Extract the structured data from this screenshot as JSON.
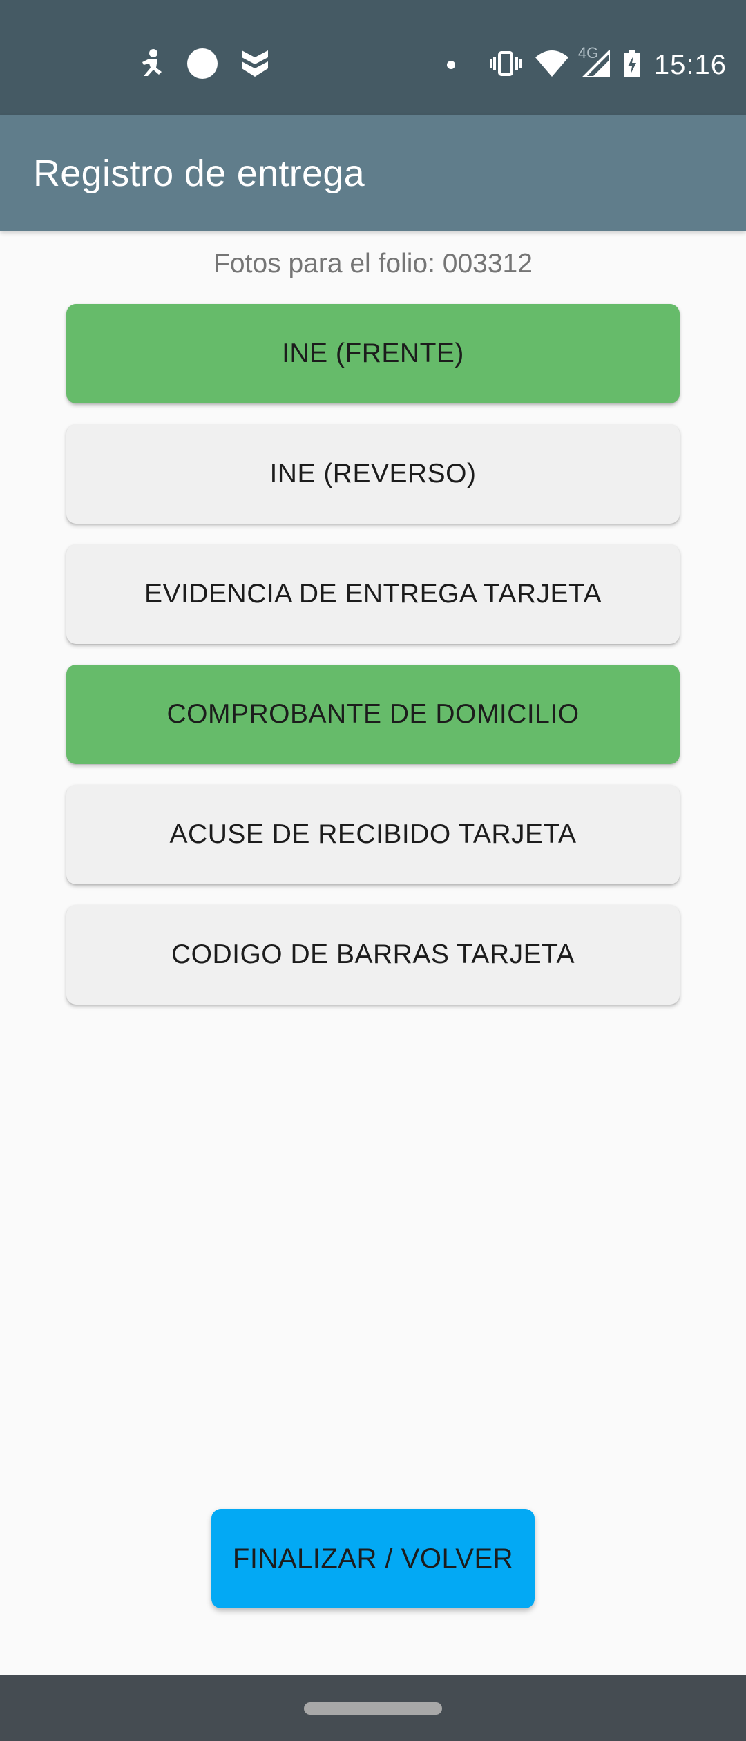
{
  "status_bar": {
    "time": "15:16",
    "network_type": "4G",
    "left_icons": [
      "accessibility-icon",
      "circle-icon",
      "badge-icon"
    ],
    "right_icons": [
      "dot-icon",
      "vibrate-icon",
      "wifi-icon",
      "signal-icon",
      "battery-charging-icon"
    ]
  },
  "app_bar": {
    "title": "Registro de entrega"
  },
  "content": {
    "folio_text": "Fotos para el folio: 003312",
    "photo_buttons": [
      {
        "label": "INE (FRENTE)",
        "completed": true
      },
      {
        "label": "INE (REVERSO)",
        "completed": false
      },
      {
        "label": "EVIDENCIA DE ENTREGA TARJETA",
        "completed": false
      },
      {
        "label": "COMPROBANTE DE DOMICILIO",
        "completed": true
      },
      {
        "label": "ACUSE DE RECIBIDO TARJETA",
        "completed": false
      },
      {
        "label": "CODIGO DE BARRAS TARJETA",
        "completed": false
      }
    ],
    "finish_button": "FINALIZAR / VOLVER"
  },
  "colors": {
    "status_bar": "#455A64",
    "app_bar": "#607D8B",
    "completed": "#66BB6A",
    "pending": "#F0F0F0",
    "finish": "#03A9F4",
    "nav_bar": "#454C52"
  }
}
